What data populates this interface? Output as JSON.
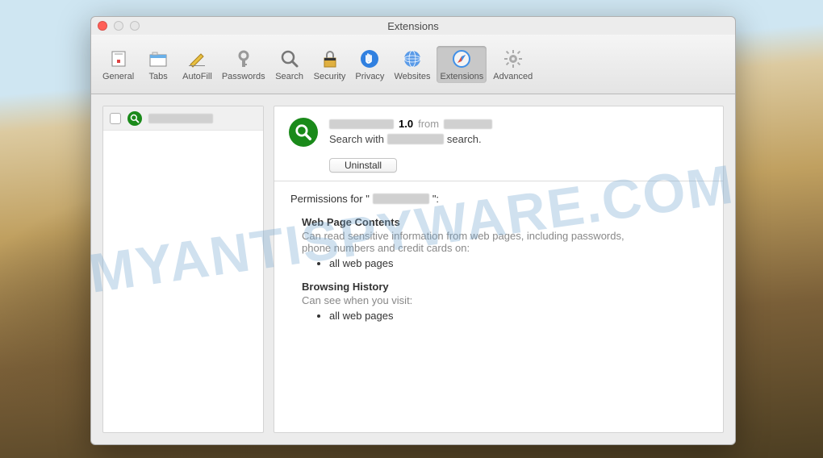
{
  "watermark": "MYANTISPYWARE.COM",
  "window": {
    "title": "Extensions"
  },
  "toolbar": [
    {
      "id": "general",
      "label": "General",
      "icon": "general"
    },
    {
      "id": "tabs",
      "label": "Tabs",
      "icon": "tabs"
    },
    {
      "id": "autofill",
      "label": "AutoFill",
      "icon": "autofill"
    },
    {
      "id": "passwords",
      "label": "Passwords",
      "icon": "passwords"
    },
    {
      "id": "search",
      "label": "Search",
      "icon": "search"
    },
    {
      "id": "security",
      "label": "Security",
      "icon": "security"
    },
    {
      "id": "privacy",
      "label": "Privacy",
      "icon": "privacy"
    },
    {
      "id": "websites",
      "label": "Websites",
      "icon": "websites"
    },
    {
      "id": "extensions",
      "label": "Extensions",
      "icon": "extensions",
      "selected": true
    },
    {
      "id": "advanced",
      "label": "Advanced",
      "icon": "advanced"
    }
  ],
  "sidebar": {
    "items": [
      {
        "enabled": false,
        "name_hidden": true,
        "icon": "search-green"
      }
    ]
  },
  "detail": {
    "name_hidden": true,
    "version": "1.0",
    "from_label": "from",
    "author_hidden": true,
    "description_prefix": "Search with",
    "description_mid_hidden": true,
    "description_suffix": "search.",
    "uninstall_label": "Uninstall",
    "permissions_label_prefix": "Permissions for \"",
    "permissions_name_hidden": true,
    "permissions_label_suffix": "\":",
    "sections": [
      {
        "heading": "Web Page Contents",
        "desc": "Can read sensitive information from web pages, including passwords, phone numbers and credit cards on:",
        "items": [
          "all web pages"
        ]
      },
      {
        "heading": "Browsing History",
        "desc": "Can see when you visit:",
        "items": [
          "all web pages"
        ]
      }
    ]
  }
}
